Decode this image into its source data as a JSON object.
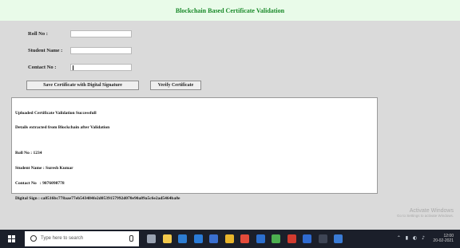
{
  "app": {
    "title": "Blockchain Based Certificate Validation"
  },
  "form": {
    "roll_label": "Roll No :",
    "roll_value": "",
    "student_label": "Student Name :",
    "student_value": "",
    "contact_label": "Contact No :",
    "contact_value": ""
  },
  "buttons": {
    "save": "Save Certificate with Digital Signature",
    "verify": "Verify Certificate"
  },
  "output": {
    "lines": [
      "Uploaded Certificate Validation Successfull",
      "Details extracted from Blockchain after Validation",
      "",
      "Roll No : 1234",
      "Student Name : Suresh Kumar",
      "Contact No   : 9876098778",
      "Digital Sign : ca8516bc778aae77eb543484fe2d0539157992d070e90a89a5c6e2ad5464ba8e"
    ]
  },
  "watermark": {
    "title": "Activate Windows",
    "subtitle": "Go to Settings to activate Windows."
  },
  "taskbar": {
    "search_placeholder": "Type here to search",
    "time": "12:00",
    "date": "20-02-2021",
    "icons": [
      "task-view-icon",
      "file-explorer-icon",
      "store-icon",
      "edge-icon",
      "mail-icon",
      "chrome-icon",
      "app-red-icon",
      "app-blue-icon",
      "app-green-icon",
      "app-red2-icon",
      "app-blue2-icon",
      "app-dark-icon",
      "app-python-icon"
    ],
    "icon_colors": [
      "#9aa3b2",
      "#f2c94c",
      "#2d7dd2",
      "#2a7bd8",
      "#3a6fd0",
      "#e9b52b",
      "#e44b3a",
      "#2c6fce",
      "#4caf50",
      "#d13b2f",
      "#2f6bd1",
      "#3e4555",
      "#3a7bd5"
    ]
  }
}
